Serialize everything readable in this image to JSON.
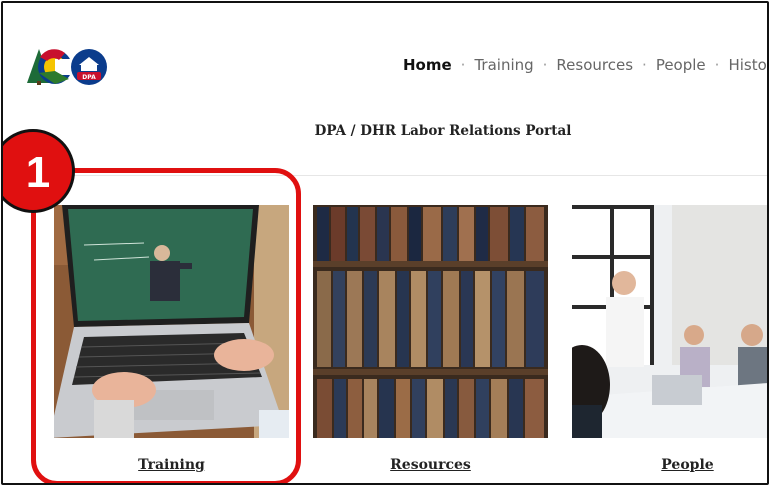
{
  "nav": {
    "items": [
      {
        "label": "Home",
        "active": true
      },
      {
        "label": "Training",
        "active": false
      },
      {
        "label": "Resources",
        "active": false
      },
      {
        "label": "People",
        "active": false
      },
      {
        "label": "History",
        "active": false
      }
    ],
    "separator": "·"
  },
  "logo": {
    "badge_text": "DPA"
  },
  "site_title": "DPA / DHR Labor Relations Portal",
  "cards": [
    {
      "caption": "Training"
    },
    {
      "caption": "Resources"
    },
    {
      "caption": "People"
    }
  ],
  "annotation": {
    "step_number": "1",
    "color": "#e01010"
  },
  "colors": {
    "nav_active": "#111111",
    "nav_inactive": "#666666"
  }
}
